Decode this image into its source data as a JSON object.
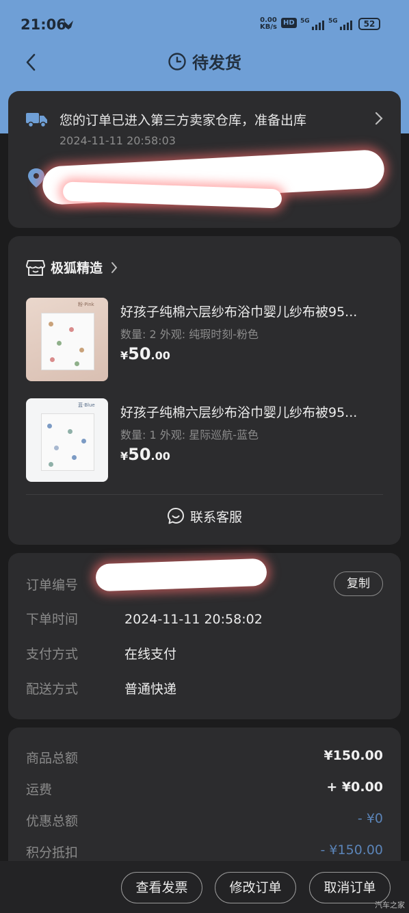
{
  "status_bar": {
    "time": "21:06",
    "speed": "0.00",
    "speed_unit": "KB/s",
    "hd": "HD",
    "net1": "5G",
    "net2": "5G",
    "battery": "52"
  },
  "nav": {
    "title": "待发货"
  },
  "shipping": {
    "message": "您的订单已进入第三方卖家仓库，准备出库",
    "time": "2024-11-11 20:58:03"
  },
  "store": {
    "name": "极狐精造"
  },
  "products": [
    {
      "name": "好孩子纯棉六层纱布浴巾婴儿纱布被95...",
      "spec": "数量: 2 外观: 纯瑕时刻-粉色",
      "currency": "¥",
      "price_int": "50",
      "price_dec": ".00",
      "thumb_tag": "粉·Pink"
    },
    {
      "name": "好孩子纯棉六层纱布浴巾婴儿纱布被95...",
      "spec": "数量: 1 外观: 星际巡航-蓝色",
      "currency": "¥",
      "price_int": "50",
      "price_dec": ".00",
      "thumb_tag": "蓝·Blue"
    }
  ],
  "customer_service": {
    "label": "联系客服"
  },
  "order_info": {
    "order_no_label": "订单编号",
    "copy_label": "复制",
    "time_label": "下单时间",
    "time_value": "2024-11-11 20:58:02",
    "pay_label": "支付方式",
    "pay_value": "在线支付",
    "delivery_label": "配送方式",
    "delivery_value": "普通快递"
  },
  "summary": {
    "goods_label": "商品总额",
    "goods_value": "¥150.00",
    "freight_label": "运费",
    "freight_value": "+ ¥0.00",
    "discount_label": "优惠总额",
    "discount_value": "- ¥0",
    "points_label": "积分抵扣",
    "points_value": "- ¥150.00"
  },
  "actions": {
    "invoice": "查看发票",
    "modify": "修改订单",
    "cancel": "取消订单"
  },
  "watermark": "汽车之家",
  "colors": {
    "header_blue": "#6f9fd6",
    "card": "#2c2c2e",
    "discount_blue": "#5b84b8"
  }
}
